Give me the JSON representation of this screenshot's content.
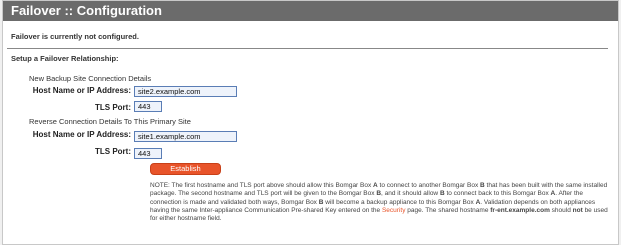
{
  "panel": {
    "title": "Failover :: Configuration"
  },
  "status_text": "Failover is currently not configured.",
  "setup_heading": "Setup a Failover Relationship:",
  "backup_section": {
    "heading": "New Backup Site Connection Details",
    "host_label": "Host Name or IP Address:",
    "host_value": "site2.example.com",
    "port_label": "TLS Port:",
    "port_value": "443"
  },
  "reverse_section": {
    "heading": "Reverse Connection Details To This Primary Site",
    "host_label": "Host Name or IP Address:",
    "host_value": "site1.example.com",
    "port_label": "TLS Port:",
    "port_value": "443"
  },
  "establish_button": "Establish Relationship",
  "note": {
    "p1": "NOTE: The first hostname and TLS port above should allow this Bomgar Box ",
    "b1": "A",
    "p2": " to connect to another Bomgar Box ",
    "b2": "B",
    "p3": " that has been built with the same installed package. The second hostname and TLS port will be given to the Bomgar Box ",
    "b3": "B",
    "p4": ", and it should allow ",
    "b4": "B",
    "p5": " to connect back to this Bomgar Box ",
    "b5": "A",
    "p6": ". After the connection is made and validated both ways, Bomgar Box ",
    "b6": "B",
    "p7": " will become a backup appliance to this Bomgar Box ",
    "b7": "A",
    "p8": ". Validation depends on both appliances having the same Inter-appliance Communication Pre-shared Key entered on the ",
    "link": "Security",
    "p9": " page. The shared hostname ",
    "b8": "fr-ent.example.com",
    "p10": " should ",
    "b9": "not",
    "p11": " be used for either hostname field."
  },
  "colors": {
    "title_bar": "#6b6b6b",
    "accent": "#e8542a",
    "field_border": "#5a7db5"
  }
}
